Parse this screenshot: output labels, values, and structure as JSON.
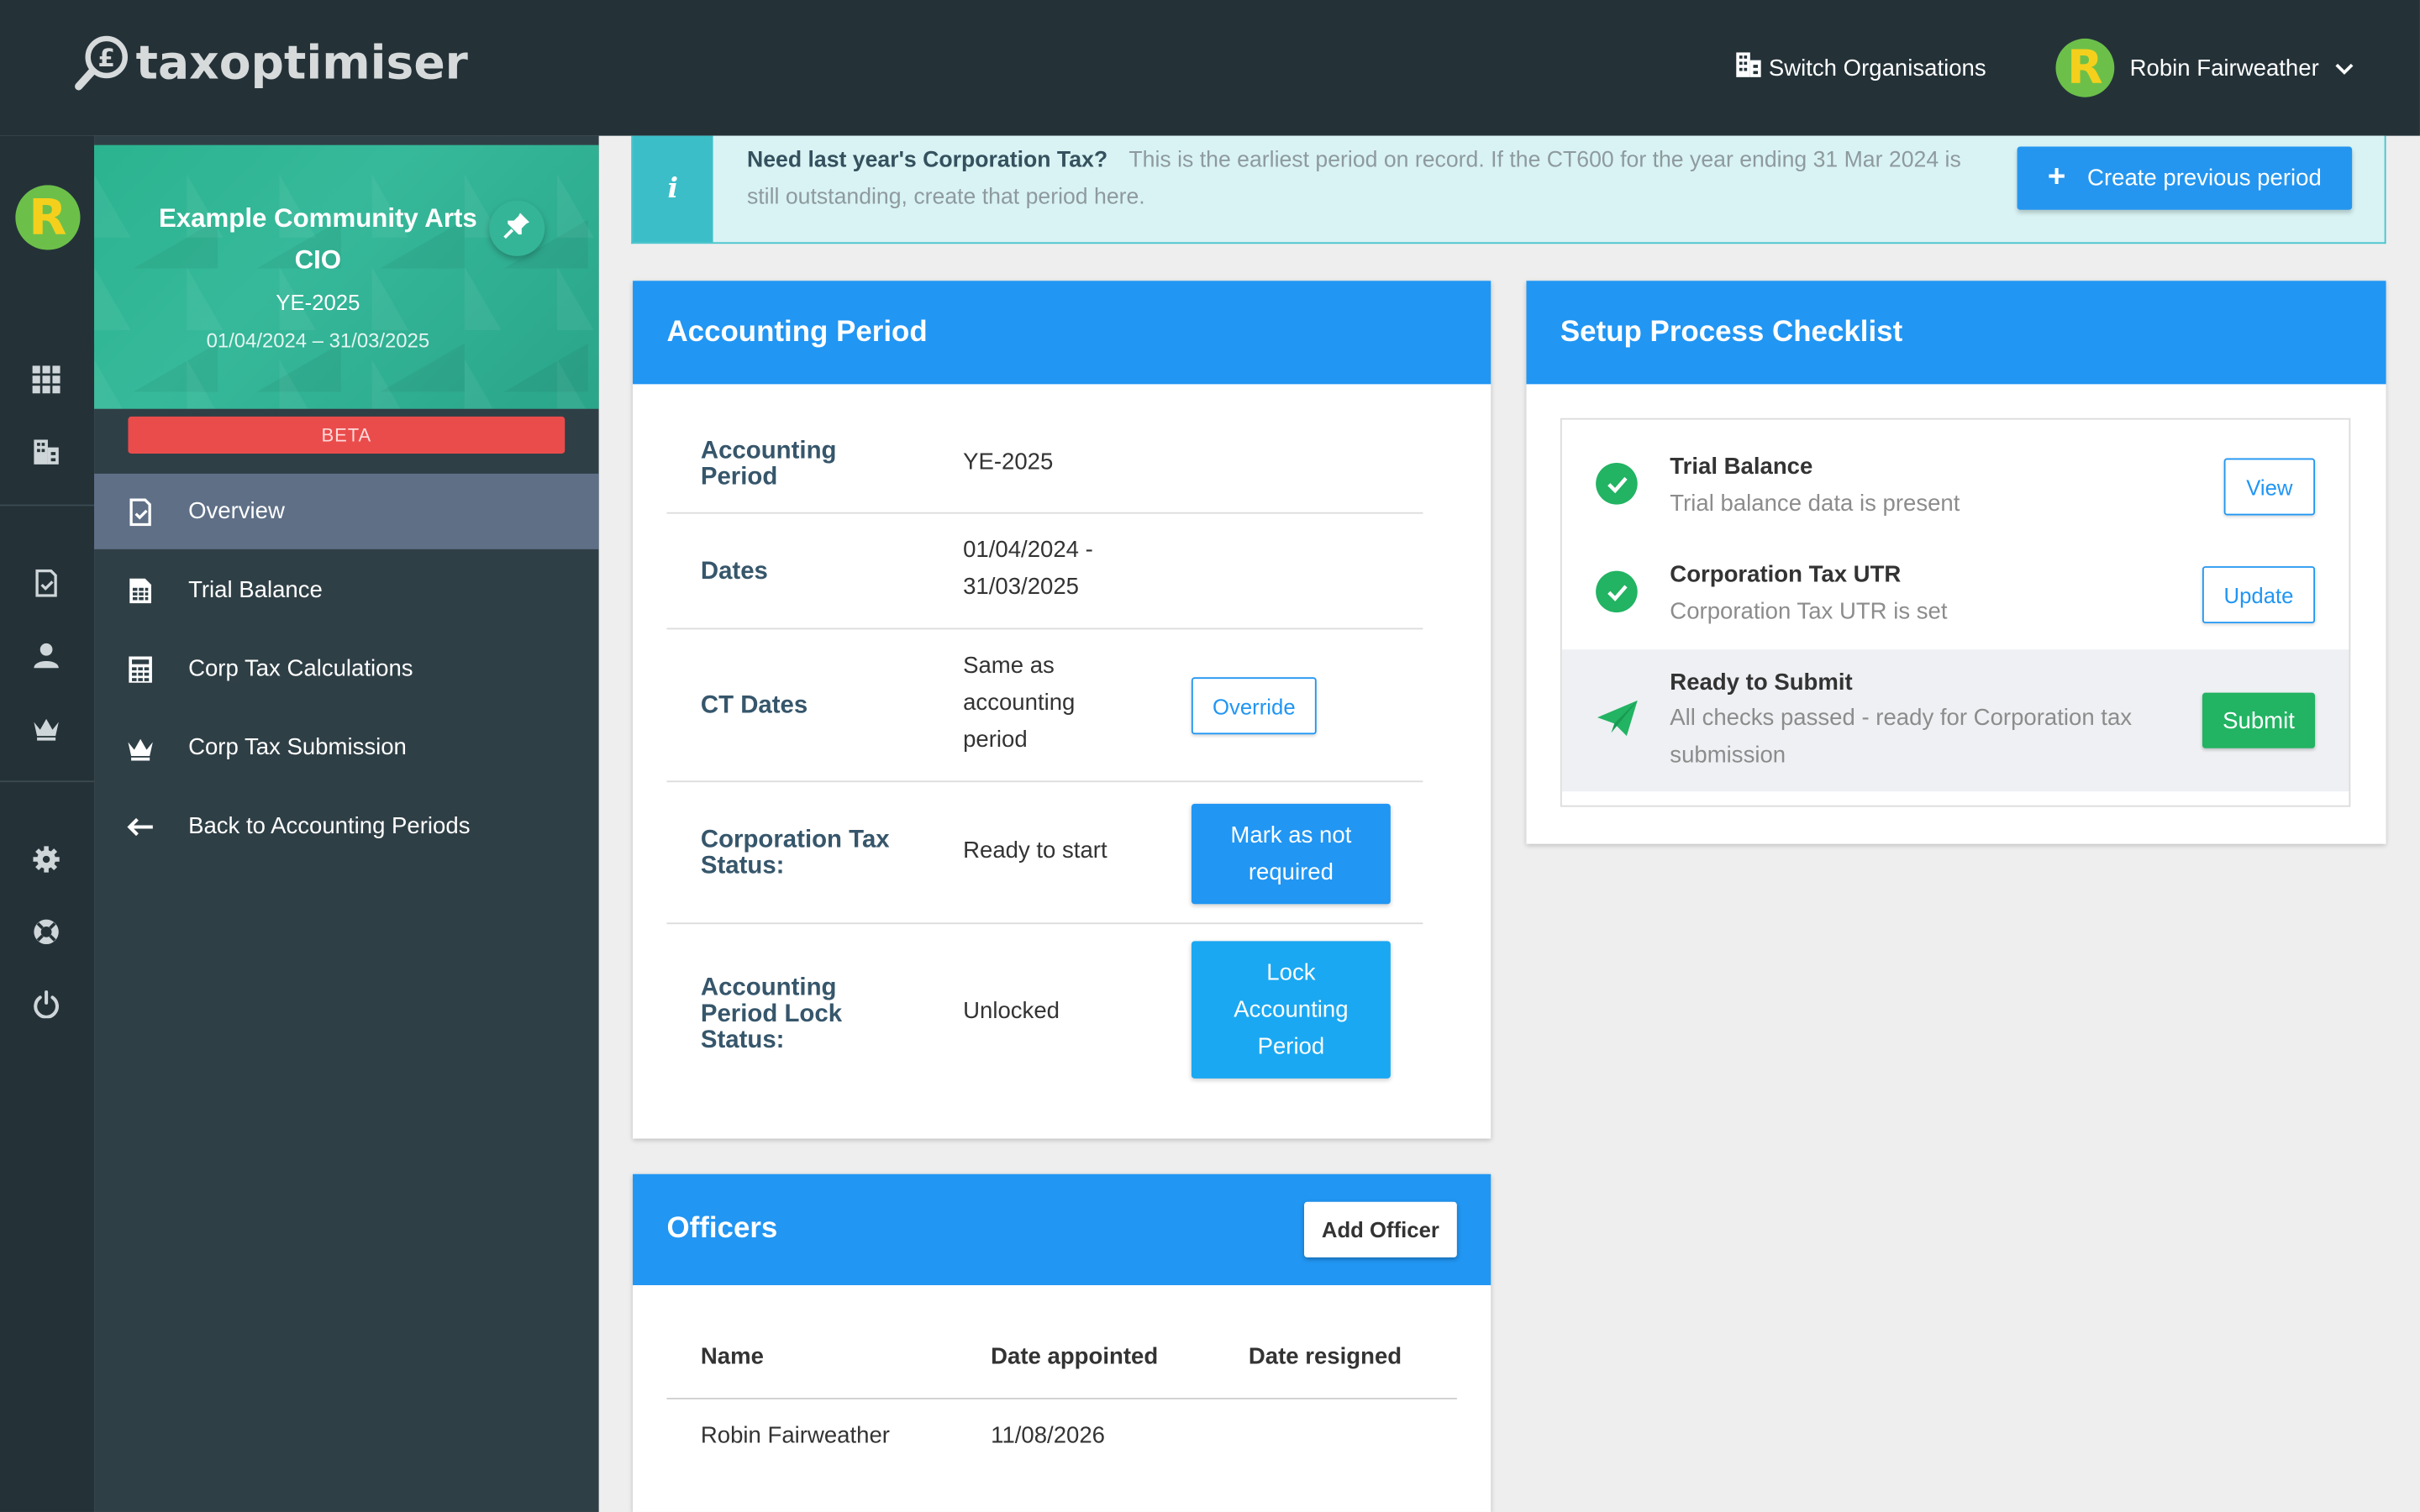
{
  "app": {
    "name": "taxoptimiser"
  },
  "header": {
    "switch_org": "Switch Organisations",
    "user_initial": "R",
    "user_name": "Robin Fairweather"
  },
  "rail": {
    "avatar_initial": "R",
    "icons": [
      "apps-grid-icon",
      "organisation-icon",
      "overview-icon",
      "user-icon",
      "crown-icon",
      "settings-icon",
      "help-lifebuoy-icon",
      "power-icon"
    ]
  },
  "org": {
    "name": "Example Community Arts CIO",
    "period": "YE-2025",
    "dates": "01/04/2024 – 31/03/2025",
    "beta": "BETA"
  },
  "nav": {
    "items": [
      {
        "label": "Overview",
        "icon": "overview-icon",
        "active": true
      },
      {
        "label": "Trial Balance",
        "icon": "spreadsheet-icon"
      },
      {
        "label": "Corp Tax Calculations",
        "icon": "calculator-icon"
      },
      {
        "label": "Corp Tax Submission",
        "icon": "crown-icon"
      },
      {
        "label": "Back to Accounting Periods",
        "icon": "arrow-left-icon"
      }
    ]
  },
  "banner": {
    "title": "Need last year's Corporation Tax?",
    "text": "This is the earliest period on record. If the CT600 for the year ending 31 Mar 2024 is still outstanding, create that period here.",
    "button": "Create previous period"
  },
  "accounting_period": {
    "title": "Accounting Period",
    "rows": [
      {
        "label": "Accounting Period",
        "value": "YE-2025"
      },
      {
        "label": "Dates",
        "value": "01/04/2024 - 31/03/2025"
      },
      {
        "label": "CT Dates",
        "value": "Same as accounting period",
        "button": "Override"
      },
      {
        "label": "Corporation Tax Status:",
        "value": "Ready to start",
        "button": "Mark as not required"
      },
      {
        "label": "Accounting Period Lock Status:",
        "value": "Unlocked",
        "button": "Lock Accounting Period"
      }
    ]
  },
  "checklist": {
    "title": "Setup Process Checklist",
    "items": [
      {
        "title": "Trial Balance",
        "sub": "Trial balance data is present",
        "button": "View",
        "status": "done"
      },
      {
        "title": "Corporation Tax UTR",
        "sub": "Corporation Tax UTR is set",
        "button": "Update",
        "status": "done"
      },
      {
        "title": "Ready to Submit",
        "sub": "All checks passed - ready for Corporation tax submission",
        "button": "Submit",
        "status": "ready"
      }
    ]
  },
  "officers": {
    "title": "Officers",
    "add_button": "Add Officer",
    "columns": [
      "Name",
      "Date appointed",
      "Date resigned"
    ],
    "rows": [
      {
        "name": "Robin Fairweather",
        "appointed": "11/08/2026",
        "resigned": ""
      }
    ]
  },
  "colors": {
    "topbar": "#243238",
    "sidebar": "#2f3f46",
    "primary": "#2196f3",
    "success": "#22b363",
    "beta": "#ea4c4c",
    "teal": "#36b99a"
  }
}
